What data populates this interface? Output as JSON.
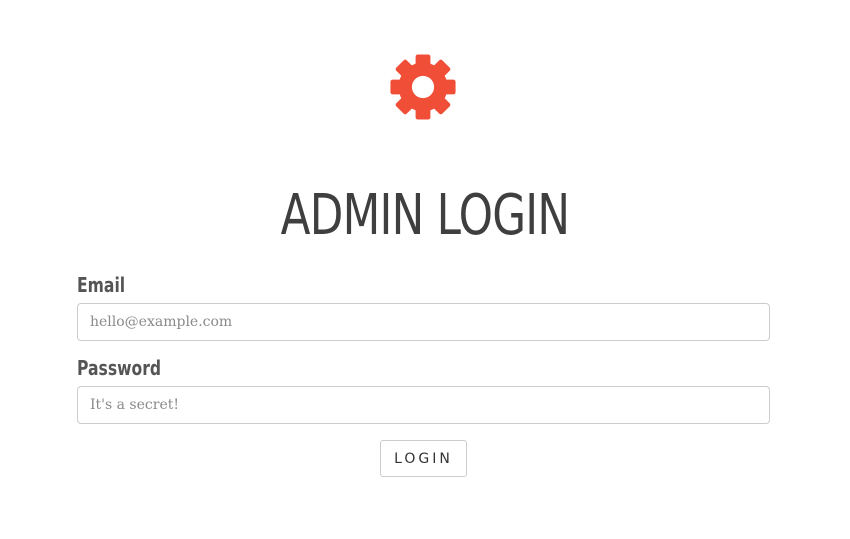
{
  "logo": {
    "icon": "gear-icon",
    "color": "#f04e37"
  },
  "header": {
    "title": "ADMIN LOGIN"
  },
  "form": {
    "email": {
      "label": "Email",
      "placeholder": "hello@example.com",
      "value": ""
    },
    "password": {
      "label": "Password",
      "placeholder": "It's a secret!",
      "value": ""
    },
    "submit_label": "LOGIN"
  }
}
